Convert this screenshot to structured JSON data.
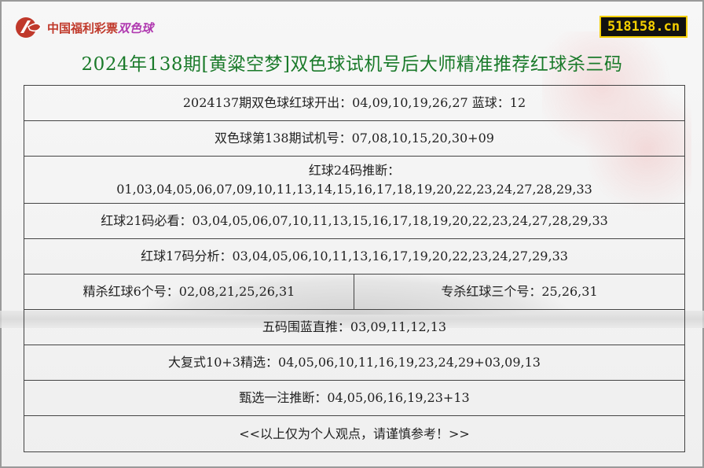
{
  "header": {
    "logo_cn": "中国福利彩票",
    "logo_ssq": "双色球",
    "site": "518158.cn",
    "title": "2024年138期[黄粱空梦]双色球试机号后大师精准推荐红球杀三码"
  },
  "rows": {
    "r1": "2024137期双色球红球开出：04,09,10,19,26,27 蓝球：12",
    "r2": "双色球第138期试机号：07,08,10,15,20,30+09",
    "r3_line1": "红球24码推断：",
    "r3_line2": "01,03,04,05,06,07,09,10,11,13,14,15,16,17,18,19,20,22,23,24,27,28,29,33",
    "r4": "红球21码必看：03,04,05,06,07,10,11,13,15,16,17,18,19,20,22,23,24,27,28,29,33",
    "r5": "红球17码分析：03,04,05,06,10,11,13,16,17,19,20,22,23,24,27,29,33",
    "r6_left": "精杀红球6个号：02,08,21,25,26,31",
    "r6_right": "专杀红球三个号：25,26,31",
    "r7": "五码围蓝直推：03,09,11,12,13",
    "r8": "大复式10+3精选：04,05,06,10,11,16,19,23,24,29+03,09,13",
    "r9": "甄选一注推断：04,05,06,16,19,23+13",
    "r10": "<<以上仅为个人观点，请谨慎参考！>>"
  },
  "colors": {
    "title": "#1a7a2a",
    "logo_red": "#c0392b",
    "logo_purple": "#b03ab0",
    "badge_bg": "#111111",
    "badge_text": "#f5d000"
  }
}
